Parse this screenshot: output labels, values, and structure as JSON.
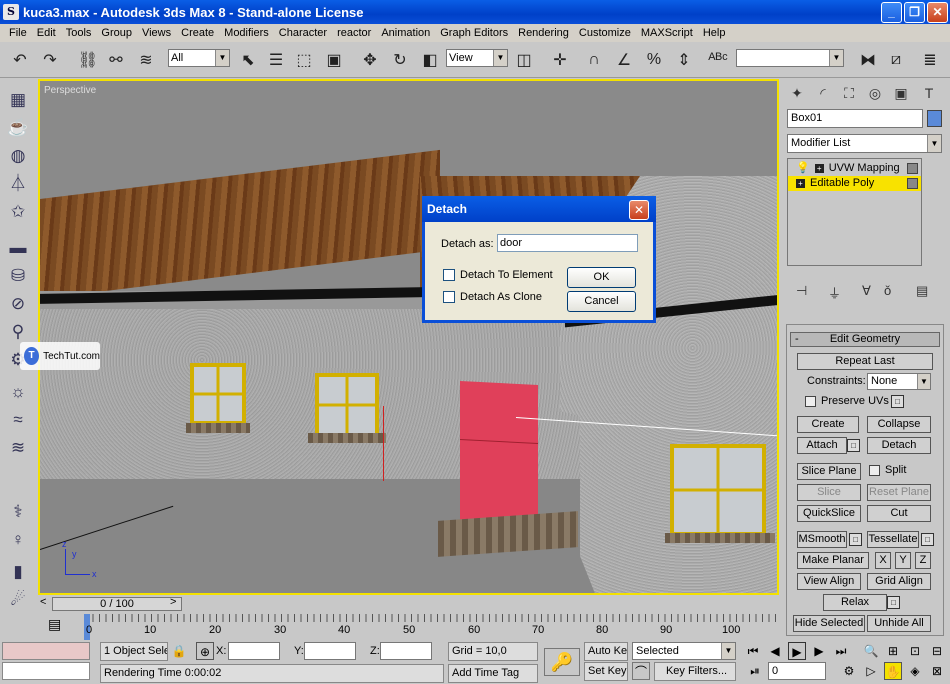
{
  "window": {
    "title": "kuca3.max - Autodesk 3ds Max 8   - Stand-alone License",
    "min": "_",
    "max": "❐",
    "close": "✕"
  },
  "menu": [
    "File",
    "Edit",
    "Tools",
    "Group",
    "Views",
    "Create",
    "Modifiers",
    "Character",
    "reactor",
    "Animation",
    "Graph Editors",
    "Rendering",
    "Customize",
    "MAXScript",
    "Help"
  ],
  "toolbar": {
    "selection_filter": "All",
    "coord_system": "View",
    "named_sel": ""
  },
  "viewport": {
    "label": "Perspective",
    "axis_x": "x",
    "axis_y": "y",
    "axis_z": "z"
  },
  "watermark": {
    "text": "TechTut.com",
    "logo": "T"
  },
  "dialog": {
    "title": "Detach",
    "detach_as_label": "Detach as:",
    "detach_as_value": "door",
    "check_element": "Detach To Element",
    "check_clone": "Detach As Clone",
    "ok": "OK",
    "cancel": "Cancel"
  },
  "command_panel": {
    "object_name": "Box01",
    "modifier_list": "Modifier List",
    "stack": [
      {
        "label": "UVW Mapping",
        "selected": false
      },
      {
        "label": "Editable Poly",
        "selected": true
      }
    ],
    "rollout_title": "Edit Geometry",
    "repeat_last": "Repeat Last",
    "constraints_label": "Constraints:",
    "constraints_value": "None",
    "preserve_uvs": "Preserve UVs",
    "create": "Create",
    "collapse": "Collapse",
    "attach": "Attach",
    "detach": "Detach",
    "slice_plane": "Slice Plane",
    "split": "Split",
    "slice": "Slice",
    "reset_plane": "Reset Plane",
    "quickslice": "QuickSlice",
    "cut": "Cut",
    "msmooth": "MSmooth",
    "tessellate": "Tessellate",
    "make_planar": "Make Planar",
    "x": "X",
    "y": "Y",
    "z": "Z",
    "view_align": "View Align",
    "grid_align": "Grid Align",
    "relax": "Relax",
    "hide_selected": "Hide Selected",
    "unhide_all": "Unhide All"
  },
  "timeline": {
    "slider": "0 / 100",
    "ticks": [
      "0",
      "10",
      "20",
      "30",
      "40",
      "50",
      "60",
      "70",
      "80",
      "90",
      "100"
    ]
  },
  "status": {
    "selection": "1 Object Sele",
    "x_label": "X:",
    "y_label": "Y:",
    "z_label": "Z:",
    "grid": "Grid = 10,0",
    "rendering_time": "Rendering Time  0:00:02",
    "add_time_tag": "Add Time Tag",
    "auto_key": "Auto Key",
    "set_key": "Set Key",
    "selected": "Selected",
    "key_filters": "Key Filters...",
    "frame": "0"
  },
  "colors": {
    "title_blue": "#0a4fd8",
    "viewport_border": "#f3e100",
    "selected_modifier": "#f8e200",
    "door": "#e0405a"
  }
}
